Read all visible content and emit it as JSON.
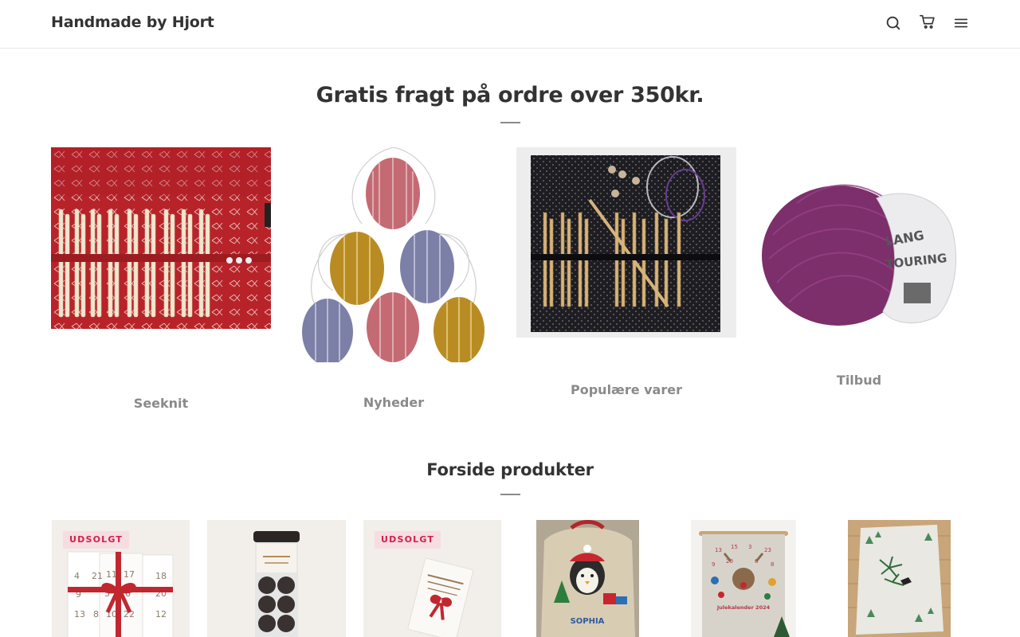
{
  "header": {
    "store_name": "Handmade by Hjort",
    "icons": [
      "search-icon",
      "cart-icon",
      "menu-icon"
    ]
  },
  "banner": {
    "title": "Gratis fragt på ordre over 350kr."
  },
  "collections": [
    {
      "label": "Seeknit"
    },
    {
      "label": "Nyheder"
    },
    {
      "label": "Populære varer"
    },
    {
      "label": "Tilbud"
    }
  ],
  "products_section": {
    "title": "Forside produkter",
    "items": [
      {
        "badge": "UDSOLGT"
      },
      {
        "badge": ""
      },
      {
        "badge": "UDSOLGT"
      },
      {
        "badge": ""
      },
      {
        "badge": ""
      },
      {
        "badge": ""
      }
    ]
  },
  "images": {
    "calendar_numbers": [
      "4",
      "21",
      "11",
      "17",
      "18",
      "9",
      "5",
      "6",
      "20",
      "13",
      "8",
      "10",
      "22",
      "12"
    ],
    "penguin_name": "SOPHIA",
    "advent_year": "Julekalender 2024"
  },
  "colors": {
    "text": "#333333",
    "muted": "#8a8a8a",
    "badge_bg": "#f6dde2",
    "badge_text": "#d22048"
  }
}
